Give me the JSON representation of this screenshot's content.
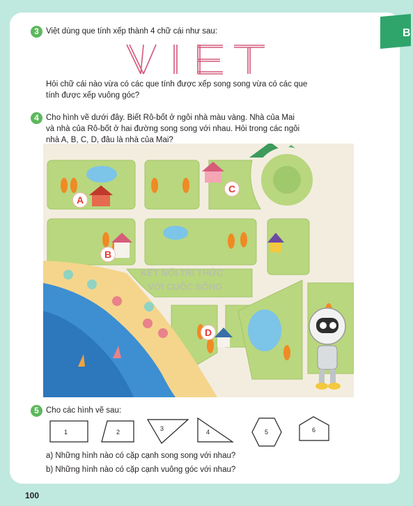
{
  "tab_letter": "B",
  "exercise3": {
    "number": "3",
    "prompt": "Việt dùng que tính xếp thành 4 chữ cái như sau:",
    "question_line1": "Hỏi chữ cái nào vừa có các que tính được xếp song song vừa có các que",
    "question_line2": "tính được xếp vuông góc?",
    "letters": [
      "V",
      "I",
      "E",
      "T"
    ]
  },
  "exercise4": {
    "number": "4",
    "line1": "Cho hình vẽ dưới đây. Biết Rô-bốt ở ngôi nhà màu vàng. Nhà của Mai",
    "line2": "và nhà của Rô-bốt ở hai đường song song với nhau. Hỏi trong các ngôi",
    "line3": "nhà A, B, C, D, đâu là nhà của Mai?",
    "houses": [
      "A",
      "B",
      "C",
      "D"
    ],
    "watermark_line1": "KẾT NỐI TRI THỨC",
    "watermark_line2": "VỚI CUỘC SỐNG"
  },
  "exercise5": {
    "number": "5",
    "prompt": "Cho các hình vẽ sau:",
    "shapes": [
      "1",
      "2",
      "3",
      "4",
      "5",
      "6"
    ],
    "question_a": "a) Những hình nào có cặp cạnh song song với nhau?",
    "question_b": "b) Những hình nào có cặp cạnh vuông góc với nhau?"
  },
  "page_number": "100",
  "colors": {
    "accent": "#5cb85c",
    "letter_stroke": "#d4587a",
    "label_red": "#e53935"
  }
}
